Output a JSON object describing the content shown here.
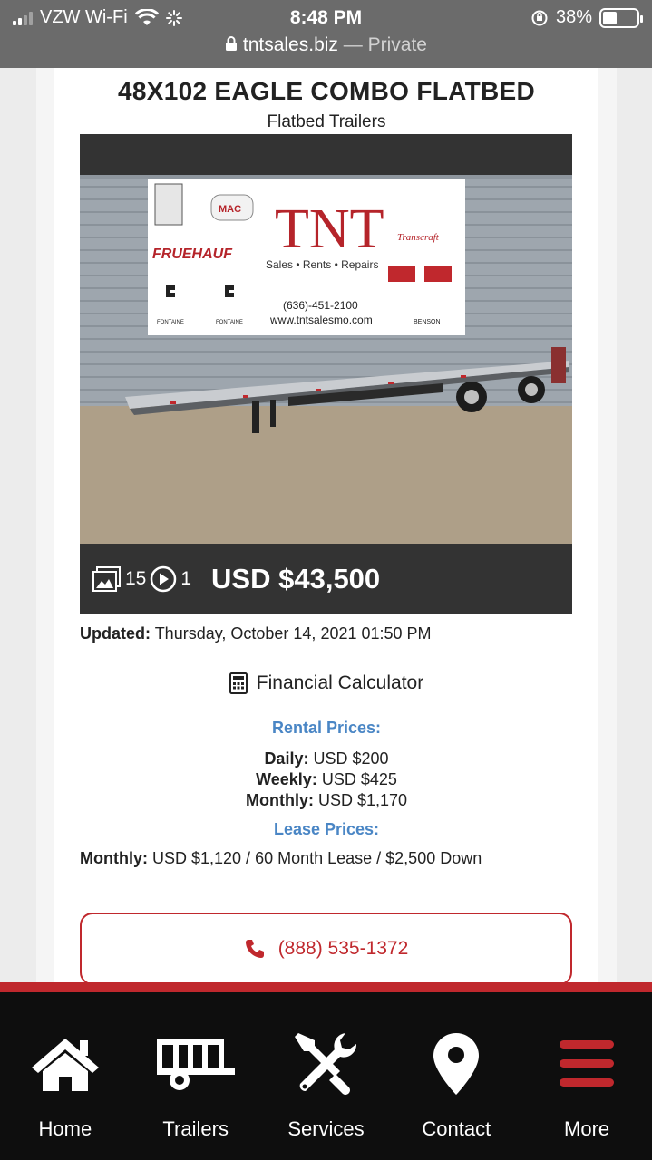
{
  "status_bar": {
    "carrier": "VZW Wi-Fi",
    "time": "8:48 PM",
    "battery": "38%"
  },
  "url_bar": {
    "domain": "tntsales.biz",
    "separator": "—",
    "mode": "Private"
  },
  "listing": {
    "title": "48X102 EAGLE COMBO FLATBED",
    "category": "Flatbed Trailers",
    "photo_count": "15",
    "video_count": "1",
    "price": "USD $43,500",
    "updated_label": "Updated:",
    "updated_value": "Thursday, October 14, 2021 01:50 PM"
  },
  "photo_banner": {
    "logo_text": "TNT",
    "tagline": "Sales • Rents • Repairs",
    "phone": "(636)-451-2100",
    "website": "www.tntsalesmo.com",
    "brand_left": "FRUEHAUF",
    "brand_right": "Transcraft",
    "brand_small_1": "FONTAINE",
    "brand_small_2": "FONTAINE",
    "brand_small_3": "BENSON",
    "brand_mac": "MAC"
  },
  "calculator": {
    "label": "Financial Calculator"
  },
  "rental": {
    "heading": "Rental Prices:",
    "daily_label": "Daily:",
    "daily_value": "USD $200",
    "weekly_label": "Weekly:",
    "weekly_value": "USD $425",
    "monthly_label": "Monthly:",
    "monthly_value": "USD $1,170"
  },
  "lease": {
    "heading": "Lease Prices:",
    "monthly_label": "Monthly:",
    "monthly_value": "USD $1,120 / 60 Month Lease / $2,500 Down"
  },
  "contact": {
    "phone": "(888) 535-1372"
  },
  "nav": {
    "home": "Home",
    "trailers": "Trailers",
    "services": "Services",
    "contact": "Contact",
    "more": "More"
  },
  "colors": {
    "brand_red": "#c0282d",
    "link_blue": "#4a86c5",
    "nav_bg": "#0e0e0e",
    "gallery_bg": "#333333"
  }
}
